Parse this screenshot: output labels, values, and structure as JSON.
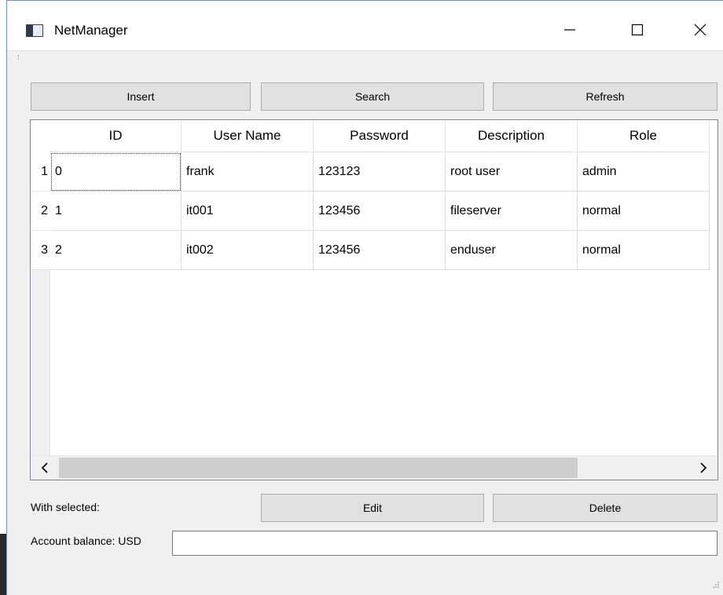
{
  "window": {
    "title": "NetManager",
    "icons": {
      "app": "app-window-icon",
      "minimize": "minimize-icon",
      "maximize": "maximize-icon",
      "close": "close-icon"
    }
  },
  "toolbar": {
    "insert_label": "Insert",
    "search_label": "Search",
    "refresh_label": "Refresh"
  },
  "table": {
    "columns": [
      "ID",
      "User Name",
      "Password",
      "Description",
      "Role"
    ],
    "rows": [
      {
        "row_number": "1",
        "cells": [
          "0",
          "frank",
          "123123",
          "root user",
          "admin"
        ]
      },
      {
        "row_number": "2",
        "cells": [
          "1",
          "it001",
          "123456",
          "fileserver",
          "normal"
        ]
      },
      {
        "row_number": "3",
        "cells": [
          "2",
          "it002",
          "123456",
          "enduser",
          "normal"
        ]
      }
    ],
    "scroll": {
      "left_icon": "chevron-left-icon",
      "right_icon": "chevron-right-icon"
    }
  },
  "actions": {
    "with_selected_label": "With selected:",
    "edit_label": "Edit",
    "delete_label": "Delete"
  },
  "balance": {
    "label": "Account balance: USD",
    "value": ""
  },
  "colors": {
    "button_bg": "#e1e1e1",
    "window_bg": "#f0f0f0",
    "border_accent": "#6d8fbd"
  }
}
